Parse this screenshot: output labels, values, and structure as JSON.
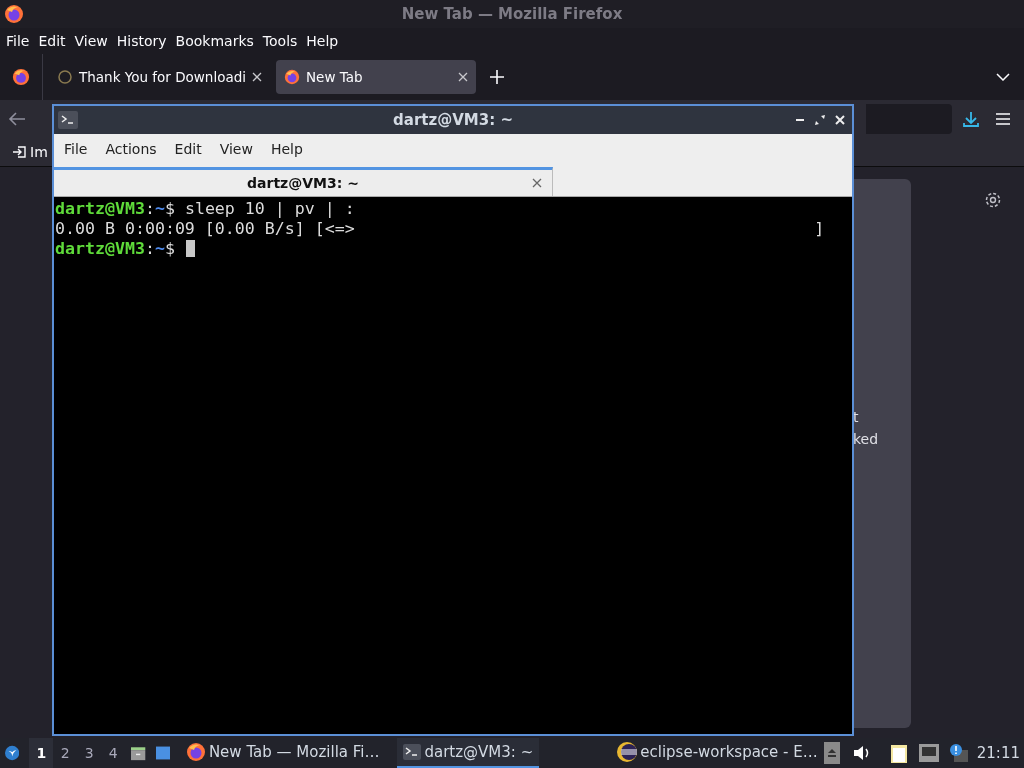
{
  "firefox": {
    "title": "New Tab — Mozilla Firefox",
    "menu": [
      "File",
      "Edit",
      "View",
      "History",
      "Bookmarks",
      "Tools",
      "Help"
    ],
    "tabs": [
      {
        "label": "Thank You for Downloadi",
        "selected": false
      },
      {
        "label": "New Tab",
        "selected": true
      }
    ],
    "bookmarks_toolbar": {
      "item": "Im"
    },
    "content": {
      "card_lines": [
        "t",
        "ked"
      ]
    }
  },
  "terminal": {
    "title": "dartz@VM3: ~",
    "menu": [
      "File",
      "Actions",
      "Edit",
      "View",
      "Help"
    ],
    "tabs": [
      {
        "label": "dartz@VM3: ~",
        "selected": true
      }
    ],
    "lines": [
      {
        "kind": "prompt",
        "user_host": "dartz@VM3",
        "separator": ":",
        "path": "~",
        "symbol": "$",
        "command": "sleep 10 | pv | :",
        "cursor": false
      },
      {
        "kind": "output",
        "text": "0.00 B 0:00:09 [0.00 B/s] [<=>                                              ]"
      },
      {
        "kind": "prompt",
        "user_host": "dartz@VM3",
        "separator": ":",
        "path": "~",
        "symbol": "$",
        "cursor": true
      }
    ]
  },
  "taskbar": {
    "workspaces": [
      {
        "label": "1",
        "selected": true
      },
      {
        "label": "2",
        "selected": false
      },
      {
        "label": "3",
        "selected": false
      },
      {
        "label": "4",
        "selected": false
      }
    ],
    "tasks": [
      {
        "kind": "firefox",
        "label": "New Tab — Mozilla Fi…",
        "selected": false
      },
      {
        "kind": "terminal",
        "label": "dartz@VM3: ~",
        "selected": true
      },
      {
        "kind": "eclipse",
        "label": "eclipse-workspace - E…",
        "selected": false
      }
    ],
    "clock": "21:11"
  }
}
